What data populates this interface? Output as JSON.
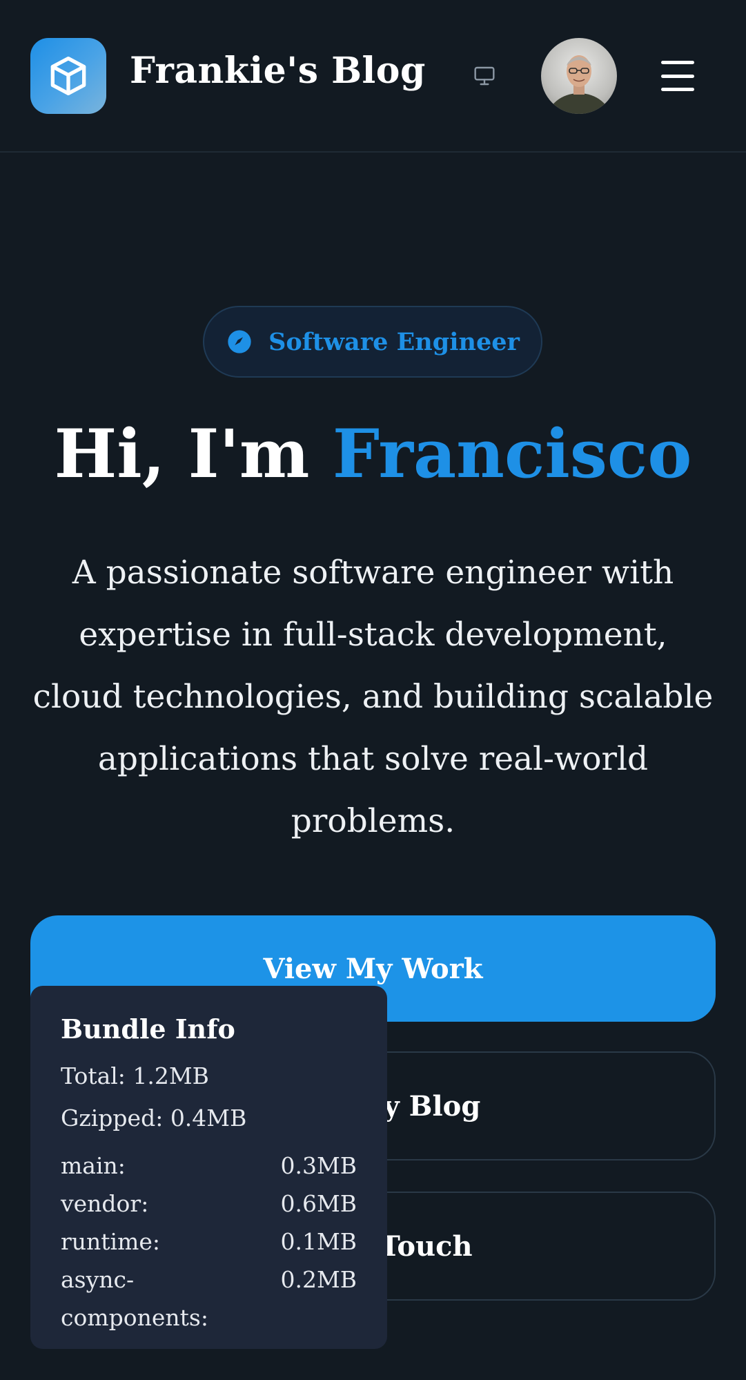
{
  "header": {
    "site_title": "Frankie's Blog",
    "logo_icon": "cube-icon",
    "theme_icon": "monitor-icon",
    "avatar_alt": "profile photo",
    "menu_icon": "hamburger-menu-icon"
  },
  "hero": {
    "badge_label": "Software Engineer",
    "badge_icon": "compass-icon",
    "title_prefix": "Hi, I'm ",
    "title_name": "Francisco",
    "description": "A passionate software engineer with expertise in full-stack development, cloud technologies, and building scalable applications that solve real-world problems."
  },
  "actions": {
    "primary_label": "View My Work",
    "blog_label": "Read My Blog",
    "contact_label": "Get In Touch"
  },
  "bundle_info": {
    "title": "Bundle Info",
    "total": "Total: 1.2MB",
    "gzipped": "Gzipped: 0.4MB",
    "chunks": [
      {
        "name": "main:",
        "size": "0.3MB"
      },
      {
        "name": "vendor:",
        "size": "0.6MB"
      },
      {
        "name": "runtime:",
        "size": "0.1MB"
      },
      {
        "name": "async-components:",
        "size": "0.2MB"
      }
    ]
  },
  "colors": {
    "background": "#121a22",
    "accent": "#1e90e6",
    "panel": "#1e2739"
  }
}
